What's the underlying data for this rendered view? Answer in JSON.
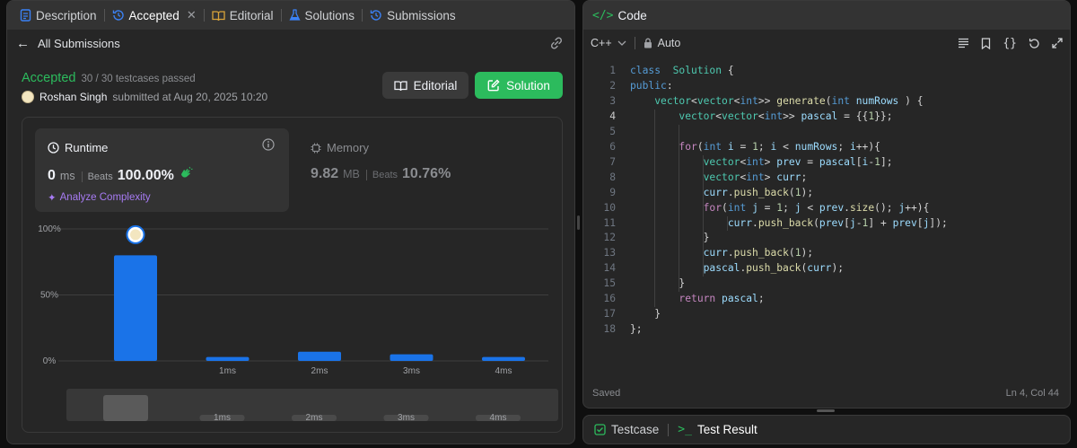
{
  "left_tabs": [
    {
      "label": "Description",
      "color": "#3b82f6"
    },
    {
      "label": "Accepted",
      "color": "#3b82f6"
    },
    {
      "label": "Editorial",
      "color": "#d9a33a"
    },
    {
      "label": "Solutions",
      "color": "#3b82f6"
    },
    {
      "label": "Submissions",
      "color": "#3b82f6"
    }
  ],
  "nav": {
    "back_label": "All Submissions"
  },
  "result": {
    "status": "Accepted",
    "testcases": "30 / 30 testcases passed",
    "author": "Roshan Singh",
    "submitted_text": "submitted at Aug 20, 2025 10:20"
  },
  "buttons": {
    "editorial": "Editorial",
    "solution": "Solution"
  },
  "runtime": {
    "label": "Runtime",
    "value": "0",
    "unit": "ms",
    "beats_label": "Beats",
    "beats": "100.00%",
    "analyze": "Analyze Complexity"
  },
  "memory": {
    "label": "Memory",
    "value": "9.82",
    "unit": "MB",
    "beats_label": "Beats",
    "beats": "10.76%"
  },
  "chart_data": {
    "type": "bar",
    "categories": [
      "0ms",
      "1ms",
      "2ms",
      "3ms",
      "4ms"
    ],
    "x_tick_labels": [
      "",
      "1ms",
      "2ms",
      "3ms",
      "4ms"
    ],
    "values": [
      80,
      3,
      7,
      5,
      3
    ],
    "y_ticks": [
      "100%",
      "50%",
      "0%"
    ],
    "ylim": [
      0,
      100
    ],
    "highlighted_index": 0,
    "overview_tick_labels": [
      "",
      "1ms",
      "2ms",
      "3ms",
      "4ms"
    ],
    "colors": {
      "bar": "#1a73e8",
      "overview_selected": "#5a5a5a",
      "overview_track": "#383838"
    }
  },
  "code_panel": {
    "title": "Code",
    "language": "C++",
    "mode": "Auto",
    "saved_text": "Saved",
    "cursor_text": "Ln 4, Col 44",
    "current_line": 4,
    "lines": [
      [
        [
          "k",
          "class"
        ],
        [
          "",
          "  "
        ],
        [
          "t",
          "Solution"
        ],
        [
          "",
          " {"
        ]
      ],
      [
        [
          "k",
          "public"
        ],
        [
          "",
          ":"
        ]
      ],
      [
        [
          "",
          "    "
        ],
        [
          "t",
          "vector"
        ],
        [
          "",
          "<"
        ],
        [
          "t",
          "vector"
        ],
        [
          "",
          "<"
        ],
        [
          "k",
          "int"
        ],
        [
          "",
          ">> "
        ],
        [
          "f",
          "generate"
        ],
        [
          "",
          "("
        ],
        [
          "k",
          "int"
        ],
        [
          "",
          " "
        ],
        [
          "v",
          "numRows"
        ],
        [
          "",
          " ) {"
        ]
      ],
      [
        [
          "",
          "        "
        ],
        [
          "t",
          "vector"
        ],
        [
          "",
          "<"
        ],
        [
          "t",
          "vector"
        ],
        [
          "",
          "<"
        ],
        [
          "k",
          "int"
        ],
        [
          "",
          ">> "
        ],
        [
          "v",
          "pascal"
        ],
        [
          "",
          " = {{"
        ],
        [
          "n",
          "1"
        ],
        [
          "",
          "}};"
        ]
      ],
      [
        [
          "",
          ""
        ]
      ],
      [
        [
          "",
          "        "
        ],
        [
          "c",
          "for"
        ],
        [
          "",
          "("
        ],
        [
          "k",
          "int"
        ],
        [
          "",
          " "
        ],
        [
          "v",
          "i"
        ],
        [
          "",
          " = "
        ],
        [
          "n",
          "1"
        ],
        [
          "",
          "; "
        ],
        [
          "v",
          "i"
        ],
        [
          "",
          " < "
        ],
        [
          "v",
          "numRows"
        ],
        [
          "",
          "; "
        ],
        [
          "v",
          "i"
        ],
        [
          "",
          "++){"
        ]
      ],
      [
        [
          "",
          "            "
        ],
        [
          "t",
          "vector"
        ],
        [
          "",
          "<"
        ],
        [
          "k",
          "int"
        ],
        [
          "",
          "> "
        ],
        [
          "v",
          "prev"
        ],
        [
          "",
          " = "
        ],
        [
          "v",
          "pascal"
        ],
        [
          "",
          "["
        ],
        [
          "v",
          "i"
        ],
        [
          "",
          "-"
        ],
        [
          "n",
          "1"
        ],
        [
          "",
          "];"
        ]
      ],
      [
        [
          "",
          "            "
        ],
        [
          "t",
          "vector"
        ],
        [
          "",
          "<"
        ],
        [
          "k",
          "int"
        ],
        [
          "",
          "> "
        ],
        [
          "v",
          "curr"
        ],
        [
          "",
          ";"
        ]
      ],
      [
        [
          "",
          "            "
        ],
        [
          "v",
          "curr"
        ],
        [
          "",
          "."
        ],
        [
          "f",
          "push_back"
        ],
        [
          "",
          "("
        ],
        [
          "n",
          "1"
        ],
        [
          "",
          ");"
        ]
      ],
      [
        [
          "",
          "            "
        ],
        [
          "c",
          "for"
        ],
        [
          "",
          "("
        ],
        [
          "k",
          "int"
        ],
        [
          "",
          " "
        ],
        [
          "v",
          "j"
        ],
        [
          "",
          " = "
        ],
        [
          "n",
          "1"
        ],
        [
          "",
          "; "
        ],
        [
          "v",
          "j"
        ],
        [
          "",
          " < "
        ],
        [
          "v",
          "prev"
        ],
        [
          "",
          "."
        ],
        [
          "f",
          "size"
        ],
        [
          "",
          "(); "
        ],
        [
          "v",
          "j"
        ],
        [
          "",
          "++){"
        ]
      ],
      [
        [
          "",
          "                "
        ],
        [
          "v",
          "curr"
        ],
        [
          "",
          "."
        ],
        [
          "f",
          "push_back"
        ],
        [
          "",
          "("
        ],
        [
          "v",
          "prev"
        ],
        [
          "",
          "["
        ],
        [
          "v",
          "j"
        ],
        [
          "",
          "-"
        ],
        [
          "n",
          "1"
        ],
        [
          "",
          "] + "
        ],
        [
          "v",
          "prev"
        ],
        [
          "",
          "["
        ],
        [
          "v",
          "j"
        ],
        [
          "",
          "]);"
        ]
      ],
      [
        [
          "",
          "            }"
        ]
      ],
      [
        [
          "",
          "            "
        ],
        [
          "v",
          "curr"
        ],
        [
          "",
          "."
        ],
        [
          "f",
          "push_back"
        ],
        [
          "",
          "("
        ],
        [
          "n",
          "1"
        ],
        [
          "",
          ");"
        ]
      ],
      [
        [
          "",
          "            "
        ],
        [
          "v",
          "pascal"
        ],
        [
          "",
          "."
        ],
        [
          "f",
          "push_back"
        ],
        [
          "",
          "("
        ],
        [
          "v",
          "curr"
        ],
        [
          "",
          ");"
        ]
      ],
      [
        [
          "",
          "        }"
        ]
      ],
      [
        [
          "",
          "        "
        ],
        [
          "c",
          "return"
        ],
        [
          "",
          " "
        ],
        [
          "v",
          "pascal"
        ],
        [
          "",
          ";"
        ]
      ],
      [
        [
          "",
          "    }"
        ]
      ],
      [
        [
          "",
          "};"
        ]
      ]
    ]
  },
  "bottom_tabs": {
    "testcase": "Testcase",
    "test_result": "Test Result"
  }
}
